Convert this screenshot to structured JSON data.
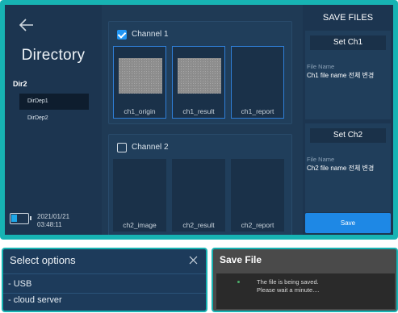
{
  "left_panel": {
    "title": "Directory",
    "dir_name": "Dir2",
    "items": [
      {
        "label": "DirDep1",
        "selected": true
      },
      {
        "label": "DirDep2",
        "selected": false
      }
    ],
    "date": "2021/01/21",
    "time": "03:48:11"
  },
  "channels": [
    {
      "label": "Channel 1",
      "checked": true,
      "tiles": [
        {
          "caption": "ch1_origin",
          "selected": true,
          "has_image": true
        },
        {
          "caption": "ch1_result",
          "selected": true,
          "has_image": true
        },
        {
          "caption": "ch1_report",
          "selected": true,
          "has_image": false
        }
      ]
    },
    {
      "label": "Channel 2",
      "checked": false,
      "tiles": [
        {
          "caption": "ch2_image",
          "selected": false,
          "has_image": false
        },
        {
          "caption": "ch2_result",
          "selected": false,
          "has_image": false
        },
        {
          "caption": "ch2_report",
          "selected": false,
          "has_image": false
        }
      ]
    }
  ],
  "right_panel": {
    "title": "SAVE FILES",
    "set1": {
      "button": "Set Ch1",
      "file_label": "File Name",
      "file_value": "Ch1 file name 전체 변경"
    },
    "set2": {
      "button": "Set Ch2",
      "file_label": "File Name",
      "file_value": "Ch2 file name 전체 변경"
    },
    "save_button": "Save"
  },
  "select_popup": {
    "title": "Select options",
    "options": [
      "- USB",
      "- cloud server"
    ]
  },
  "save_popup": {
    "title": "Save File",
    "message_line1": "The file is being saved.",
    "message_line2": "Please wait a minute...."
  },
  "colors": {
    "frame": "#17b3b3",
    "accent": "#1e88e5",
    "background": "#1f3a55"
  }
}
